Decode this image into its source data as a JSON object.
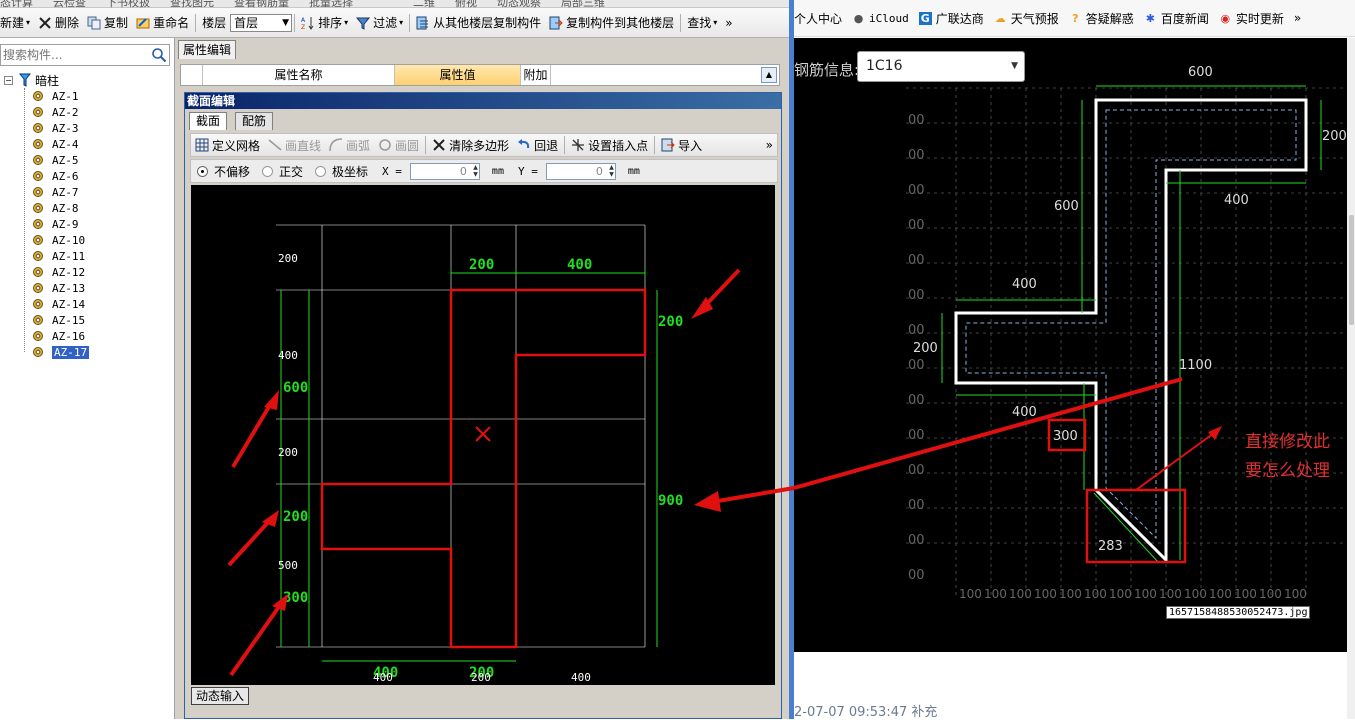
{
  "toolbar_top": {
    "items": [
      "态计算",
      "云检查",
      "下书校扱",
      "查找图元",
      "查看钢筋量",
      "批量选择",
      "二维",
      "俯视",
      "动态观察",
      "局部三维"
    ]
  },
  "toolbar": {
    "new_label": "新建",
    "delete_label": "删除",
    "copy_label": "复制",
    "rename_label": "重命名",
    "floor_label": "楼层",
    "floor_value": "首层",
    "sort_label": "排序",
    "filter_label": "过滤",
    "copy_from_floor_label": "从其他楼层复制构件",
    "copy_to_floor_label": "复制构件到其他楼层",
    "find_label": "查找",
    "more": "»"
  },
  "tree": {
    "search_placeholder": "搜索构件...",
    "root_label": "暗柱",
    "items": [
      "AZ-1",
      "AZ-2",
      "AZ-3",
      "AZ-4",
      "AZ-5",
      "AZ-6",
      "AZ-7",
      "AZ-8",
      "AZ-9",
      "AZ-10",
      "AZ-11",
      "AZ-12",
      "AZ-13",
      "AZ-14",
      "AZ-15",
      "AZ-16",
      "AZ-17"
    ],
    "selected": "AZ-17"
  },
  "prop_panel": {
    "tab_label": "属性编辑",
    "col_name": "属性名称",
    "col_value": "属性值",
    "col_extra": "附加"
  },
  "section_dialog": {
    "title": "截面编辑",
    "tab_section": "截面",
    "tab_rebar": "配筋",
    "tools": {
      "define_grid": "定义网格",
      "draw_line": "画直线",
      "draw_arc": "画弧",
      "draw_circle": "画圆",
      "clear_polygon": "清除多边形",
      "undo": "回退",
      "set_insert_point": "设置插入点",
      "import": "导入",
      "more": "»"
    },
    "snap": {
      "no_offset": "不偏移",
      "ortho": "正交",
      "polar": "极坐标",
      "x_label": "X =",
      "x_value": "0",
      "y_label": "Y =",
      "y_value": "0",
      "unit": "mm"
    },
    "dynamic_input": "动态输入",
    "canvas": {
      "left_grid_labels": [
        "200",
        "400",
        "200",
        "500"
      ],
      "left_dims": [
        "600",
        "200",
        "300"
      ],
      "top_dims": [
        "200",
        "400"
      ],
      "right_dims": [
        "200",
        "900"
      ],
      "bottom_dims": [
        "400",
        "200"
      ],
      "bottom_grid_labels": [
        "400",
        "200",
        "400"
      ]
    }
  },
  "browser": {
    "bookmarks": [
      "个人中心",
      "iCloud",
      "广联达商",
      "天气预报",
      "答疑解惑",
      "百度新闻",
      "实时更新"
    ],
    "more": "»",
    "rebar_label": "钢筋信息:",
    "rebar_value": "1C16",
    "cad": {
      "top_dims": [
        "600",
        "200",
        "400",
        "600"
      ],
      "mid_dims": [
        "400",
        "200",
        "400"
      ],
      "long_dim": "1100",
      "boxed_dim": "300",
      "diag_dim": "283",
      "left_ticks": [
        "00",
        "00",
        "00",
        "00",
        "00",
        "00",
        "00",
        "00",
        "00",
        "00",
        "00",
        "00",
        "00",
        "00"
      ],
      "bottom_ticks": [
        "100",
        "100",
        "100",
        "100",
        "100",
        "100",
        "100",
        "100",
        "100",
        "100",
        "100",
        "100",
        "100",
        "100"
      ],
      "filename": "1657158488530052473.jpg",
      "annotation_line1": "直接修改此",
      "annotation_line2": "要怎么处理"
    },
    "timestamp": "2-07-07 09:53:47 补充"
  },
  "colors": {
    "accent_red": "#e01010",
    "dim_green": "#22dd22",
    "title_blue": "#0a246a"
  }
}
